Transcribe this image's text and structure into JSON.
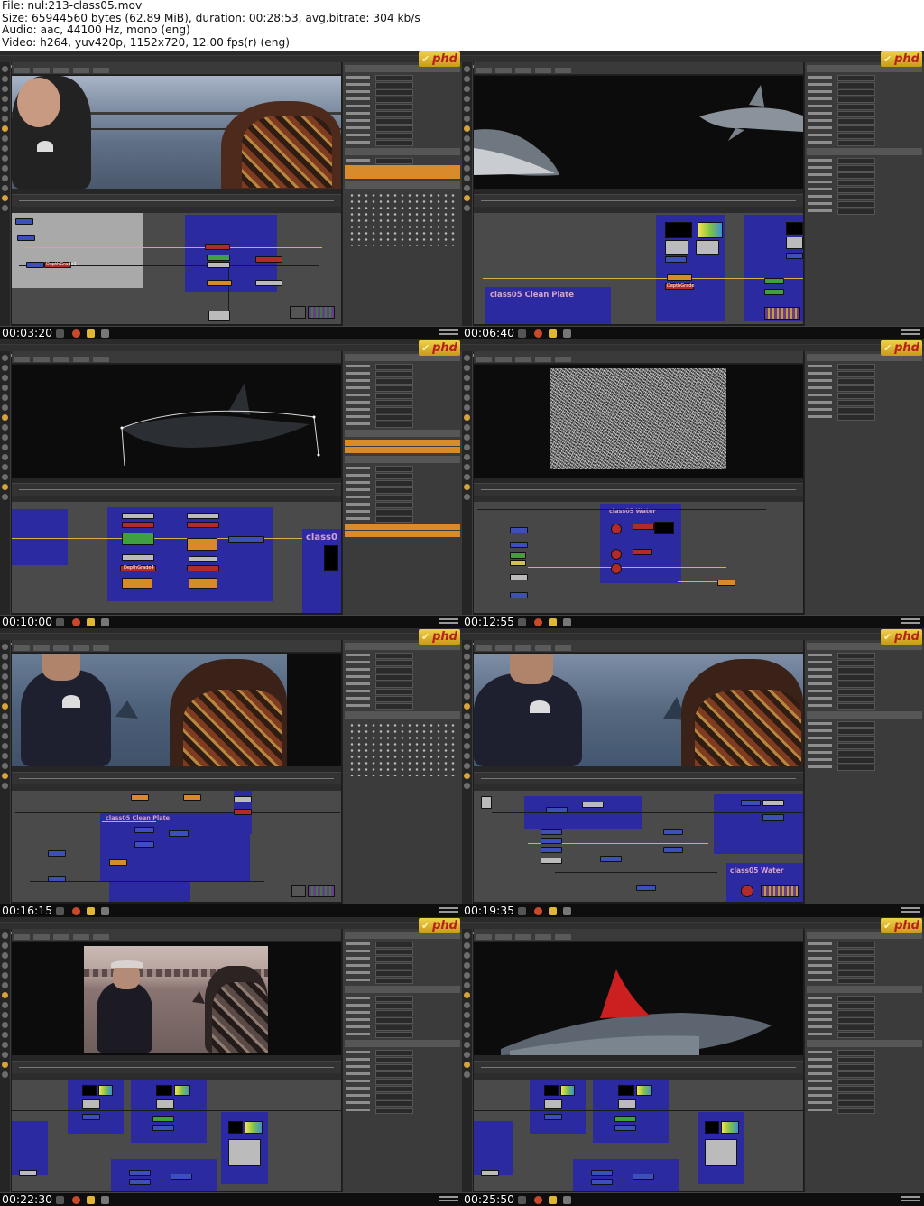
{
  "header": {
    "file": "File: nul:213-class05.mov",
    "size": "Size: 65944560 bytes (62.89 MiB), duration: 00:28:53, avg.bitrate: 304 kb/s",
    "audio": "Audio: aac, 44100 Hz, mono (eng)",
    "video": "Video: h264, yuv420p, 1152x720, 12.00 fps(r) (eng)"
  },
  "logo_text": "phd",
  "thumbnails": [
    {
      "timestamp": "00:03:20",
      "scene": "pier-people",
      "backdrop_label": "",
      "node_label": "DepthGrade1"
    },
    {
      "timestamp": "00:06:40",
      "scene": "sharks-dark",
      "backdrop_label": "class05 Clean Plate",
      "node_label": "DepthGrade"
    },
    {
      "timestamp": "00:10:00",
      "scene": "shark-wireframe",
      "backdrop_label": "class0",
      "node_label": "DepthGrade4"
    },
    {
      "timestamp": "00:12:55",
      "scene": "noise",
      "backdrop_label": "class05 Water",
      "node_label": ""
    },
    {
      "timestamp": "00:16:15",
      "scene": "people-water-fin",
      "backdrop_label": "class05 Clean Plate",
      "node_label": ""
    },
    {
      "timestamp": "00:19:35",
      "scene": "people-water-fin-2",
      "backdrop_label": "class05 Water",
      "node_label": ""
    },
    {
      "timestamp": "00:22:30",
      "scene": "harbor-people",
      "backdrop_label": "",
      "node_label": ""
    },
    {
      "timestamp": "00:25:50",
      "scene": "shark-red-fin",
      "backdrop_label": "",
      "node_label": ""
    }
  ],
  "colors": {
    "backdrop": "#2c2aa0",
    "logo_bg": "#e0b733",
    "logo_text": "#b5211a",
    "accent_orange": "#d98b2b"
  },
  "icons": [
    "nuke-tool-icon",
    "taskbar-app-icon",
    "phd-logo-icon"
  ]
}
